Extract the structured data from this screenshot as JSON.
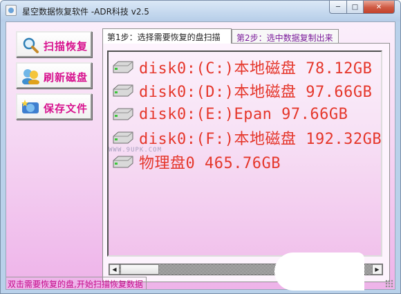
{
  "window": {
    "title": "星空数据恢复软件  -ADR科技 v2.5",
    "min_label": "─",
    "max_label": "□",
    "close_label": "✕"
  },
  "sidebar": {
    "scan_label": "扫描恢复",
    "refresh_label": "刷新磁盘",
    "save_label": "保存文件"
  },
  "tabs": [
    {
      "label": "第1步：选择需要恢复的盘扫描",
      "active": true
    },
    {
      "label": "第2步：选中数据复制出来",
      "active": false
    }
  ],
  "disks": [
    {
      "label": "disk0:(C:)本地磁盘 78.12GB"
    },
    {
      "label": "disk0:(D:)本地磁盘 97.66GB"
    },
    {
      "label": "disk0:(E:)Epan 97.66GB"
    },
    {
      "label": "disk0:(F:)本地磁盘 192.32GB"
    },
    {
      "label": "物理盘0 465.76GB"
    }
  ],
  "watermark": "WWW.9UPK.COM",
  "scrollbar": {
    "left_arrow": "◀",
    "right_arrow": "▶"
  },
  "status": {
    "text": "双击需要恢复的盘,开始扫描恢复数据"
  },
  "colors": {
    "accent_magenta": "#d8138f",
    "disk_text": "#e5372b",
    "status_text": "#c40b8a",
    "pink_bg": "#eeb3e9"
  }
}
